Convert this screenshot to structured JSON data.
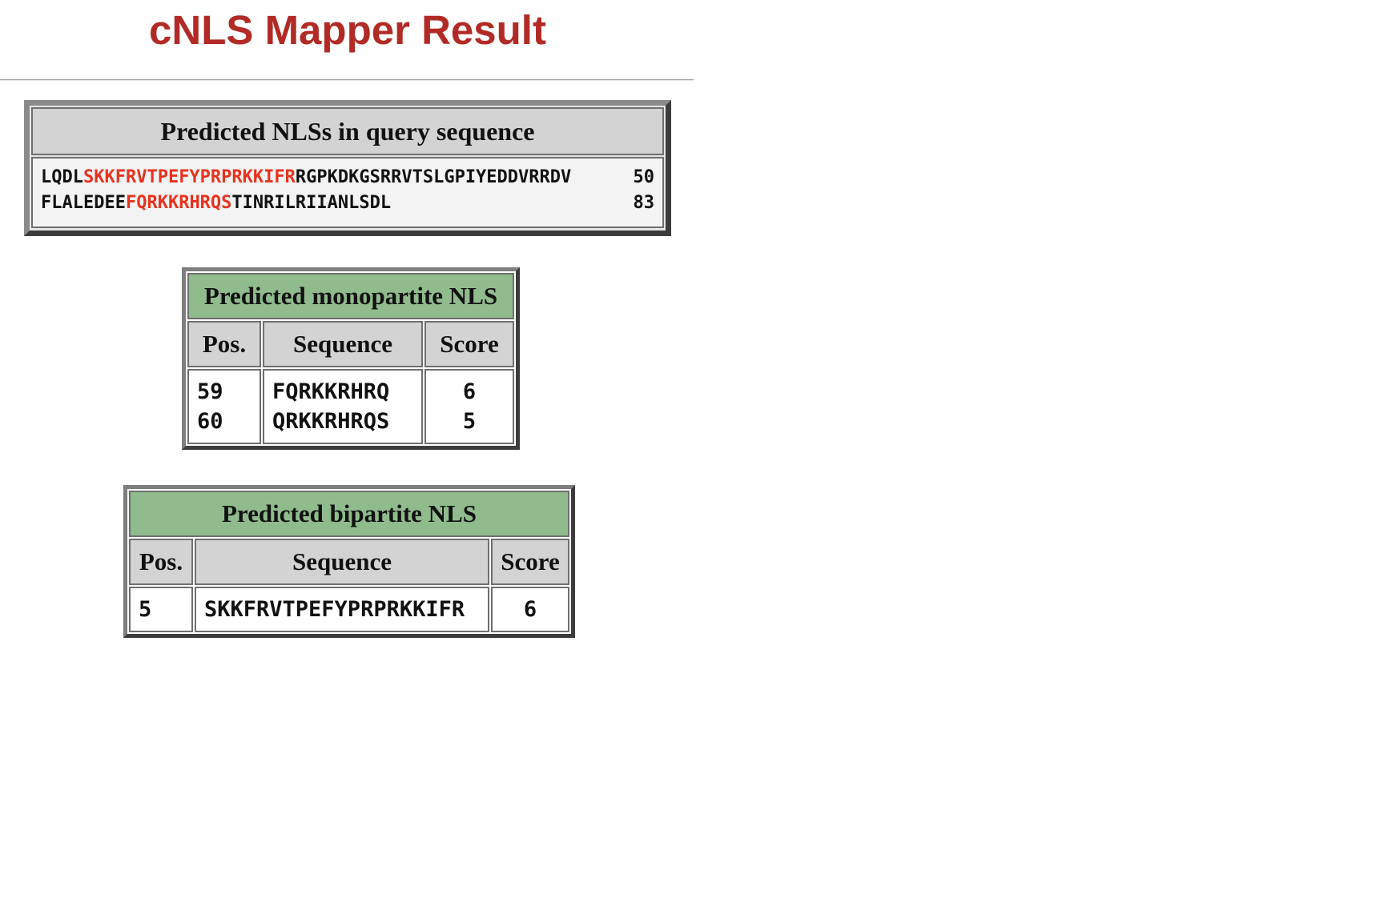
{
  "page": {
    "title": "cNLS Mapper Result"
  },
  "query": {
    "header": "Predicted NLSs in query sequence",
    "lines": [
      {
        "segments": [
          {
            "text": "LQDL",
            "highlight": false
          },
          {
            "text": "SKKFRVTPEFYPRPRKKIFR",
            "highlight": true
          },
          {
            "text": "RGPKDKGSRRVTSLGPIYEDDVRRDV",
            "highlight": false
          }
        ],
        "number": "50"
      },
      {
        "segments": [
          {
            "text": "FLALEDEE",
            "highlight": false
          },
          {
            "text": "FQRKKRHRQS",
            "highlight": true
          },
          {
            "text": "TINRILRIIANLSDL",
            "highlight": false
          }
        ],
        "number": "83"
      }
    ]
  },
  "monopartite": {
    "caption": "Predicted monopartite NLS",
    "columns": [
      "Pos.",
      "Sequence",
      "Score"
    ],
    "rows": [
      {
        "pos": "59",
        "sequence": "FQRKKRHRQ",
        "score": "6"
      },
      {
        "pos": "60",
        "sequence": "QRKKRHRQS",
        "score": "5"
      }
    ]
  },
  "bipartite": {
    "caption": "Predicted bipartite NLS",
    "columns": [
      "Pos.",
      "Sequence",
      "Score"
    ],
    "rows": [
      {
        "pos": "5",
        "sequence": "SKKFRVTPEFYPRPRKKIFR",
        "score": "6"
      }
    ]
  },
  "colors": {
    "title": "#b22a25",
    "highlight": "#e8321e",
    "caption_bg": "#90bb8d",
    "header_bg": "#d3d3d3"
  }
}
